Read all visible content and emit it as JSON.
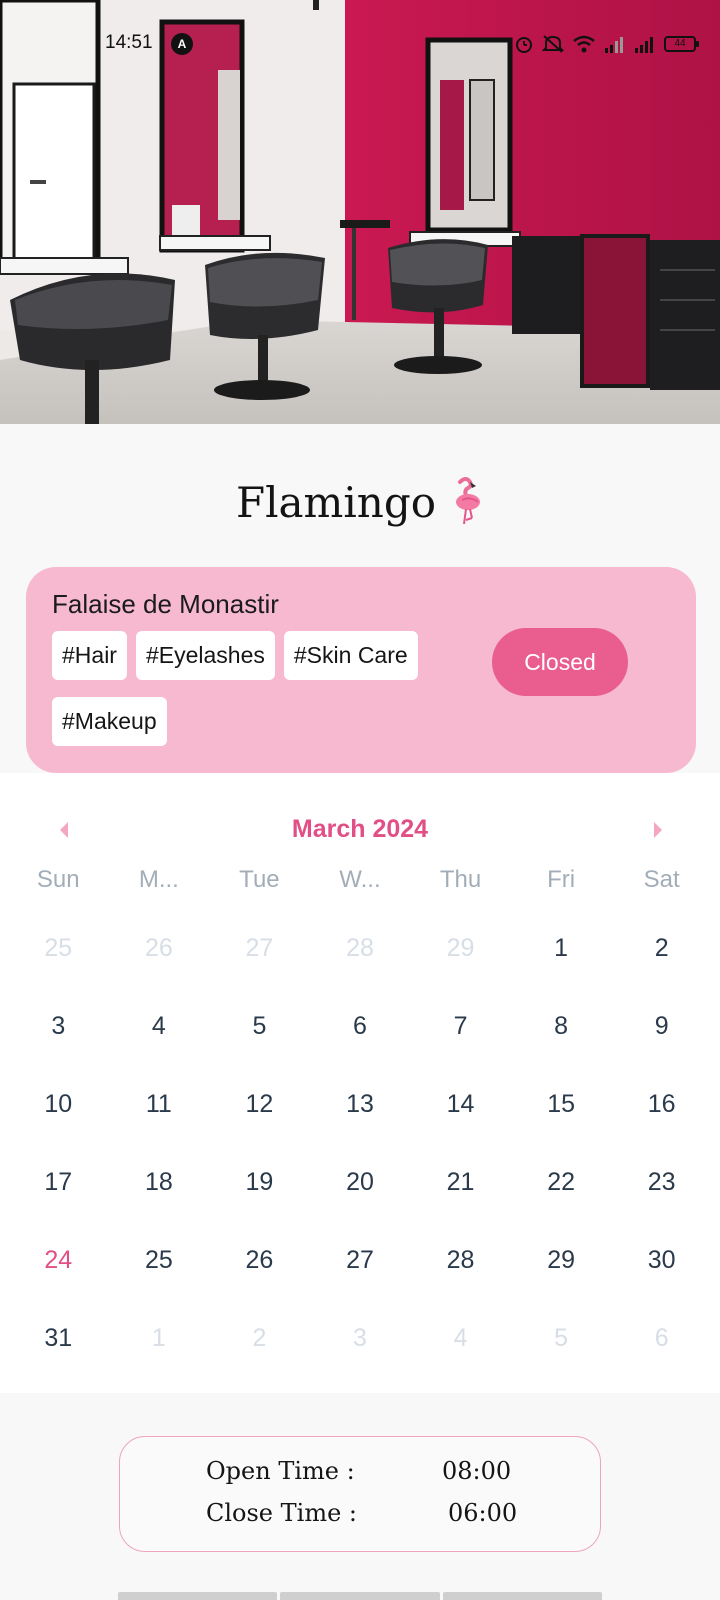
{
  "status_bar": {
    "time": "14:51",
    "app_icon": "A",
    "battery": "44",
    "icons": [
      "alarm-icon",
      "mute-icon",
      "wifi-icon",
      "signal-icon",
      "signal-icon",
      "battery-icon"
    ]
  },
  "hero": {
    "image": "salon-interior-photo"
  },
  "salon": {
    "name": "Flamingo",
    "emoji": "flamingo-icon",
    "location": "Falaise de Monastir",
    "tags": [
      "#Hair",
      "#Eyelashes",
      "#Skin Care",
      "#Makeup"
    ],
    "status": "Closed"
  },
  "calendar": {
    "month_label": "March 2024",
    "weekdays": [
      "Sun",
      "M...",
      "Tue",
      "W...",
      "Thu",
      "Fri",
      "Sat"
    ],
    "weeks": [
      [
        {
          "d": "25",
          "m": true
        },
        {
          "d": "26",
          "m": true
        },
        {
          "d": "27",
          "m": true
        },
        {
          "d": "28",
          "m": true
        },
        {
          "d": "29",
          "m": true
        },
        {
          "d": "1"
        },
        {
          "d": "2"
        }
      ],
      [
        {
          "d": "3"
        },
        {
          "d": "4"
        },
        {
          "d": "5"
        },
        {
          "d": "6"
        },
        {
          "d": "7"
        },
        {
          "d": "8"
        },
        {
          "d": "9"
        }
      ],
      [
        {
          "d": "10"
        },
        {
          "d": "11"
        },
        {
          "d": "12"
        },
        {
          "d": "13"
        },
        {
          "d": "14"
        },
        {
          "d": "15"
        },
        {
          "d": "16"
        }
      ],
      [
        {
          "d": "17"
        },
        {
          "d": "18"
        },
        {
          "d": "19"
        },
        {
          "d": "20"
        },
        {
          "d": "21"
        },
        {
          "d": "22"
        },
        {
          "d": "23"
        }
      ],
      [
        {
          "d": "24",
          "today": true
        },
        {
          "d": "25"
        },
        {
          "d": "26"
        },
        {
          "d": "27"
        },
        {
          "d": "28"
        },
        {
          "d": "29"
        },
        {
          "d": "30"
        }
      ],
      [
        {
          "d": "31"
        },
        {
          "d": "1",
          "m": true
        },
        {
          "d": "2",
          "m": true
        },
        {
          "d": "3",
          "m": true
        },
        {
          "d": "4",
          "m": true
        },
        {
          "d": "5",
          "m": true
        },
        {
          "d": "6",
          "m": true
        }
      ]
    ]
  },
  "hours": {
    "open_label": "Open Time :",
    "open_value": "08:00",
    "close_label": "Close Time :",
    "close_value": "06:00"
  },
  "colors": {
    "accent": "#e14f86",
    "card_bg": "#f7b9cf",
    "status_bg": "#ea5d8f",
    "hours_border": "#eea5bd"
  }
}
